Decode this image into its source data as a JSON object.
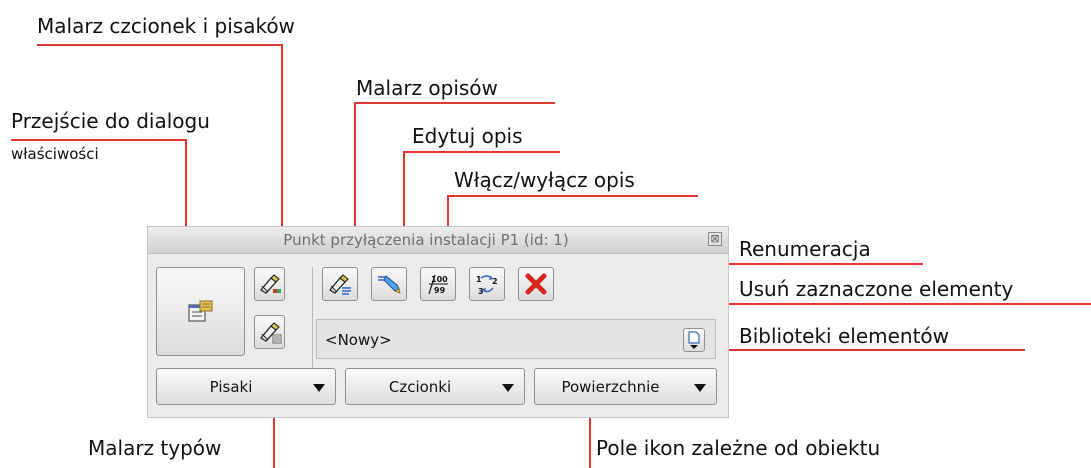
{
  "callouts": {
    "malarz_czcionek": "Malarz czcionek i pisaków",
    "przejscie_line1": "Przejście do dialogu",
    "przejscie_line2": "właściwości",
    "malarz_opisow": "Malarz opisów",
    "edytuj_opis": "Edytuj opis",
    "wlacz_wylacz": "Włącz/wyłącz opis",
    "renumeracja": "Renumeracja",
    "usun": "Usuń zaznaczone elementy",
    "biblioteki": "Biblioteki elementów",
    "malarz_typow": "Malarz typów",
    "pole_ikon": "Pole ikon zależne od obiektu"
  },
  "panel": {
    "title": "Punkt przyłączenia instalacji P1 (id: 1)",
    "close_glyph": "⊠",
    "combo_value": "<Nowy>",
    "dropdowns": [
      "Pisaki",
      "Czcionki",
      "Powierzchnie"
    ]
  },
  "icons": {
    "properties": "properties-dialog-icon",
    "font_painter": "font-pen-painter-icon",
    "type_painter": "type-painter-icon",
    "label_painter": "label-painter-icon",
    "edit_label": "edit-label-icon",
    "toggle_label": "toggle-label-icon",
    "renumber": "renumber-icon",
    "delete": "delete-icon",
    "library": "element-library-icon"
  },
  "colors": {
    "leader_line": "#e0362f",
    "delete_red": "#d42a1e"
  }
}
